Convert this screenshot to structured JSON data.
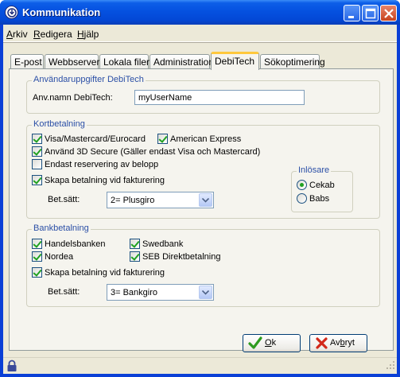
{
  "window": {
    "title": "Kommunikation"
  },
  "menu": {
    "arkiv_first": "A",
    "arkiv_rest": "rkiv",
    "redigera_first": "R",
    "redigera_rest": "edigera",
    "hjalp_first": "H",
    "hjalp_rest": "jälp"
  },
  "tabs": [
    {
      "label": "E-post"
    },
    {
      "label": "Webbserver"
    },
    {
      "label": "Lokala filer"
    },
    {
      "label": "Administration"
    },
    {
      "label": "DebiTech"
    },
    {
      "label": "Sökoptimering"
    }
  ],
  "active_tab": "DebiTech",
  "user_group": {
    "title": "Användaruppgifter DebiTech",
    "username_label": "Anv.namn DebiTech:",
    "username_value": "myUserName"
  },
  "card_group": {
    "title": "Kortbetalning",
    "visa": {
      "label": "Visa/Mastercard/Eurocard",
      "checked": true
    },
    "amex": {
      "label": "American Express",
      "checked": true
    },
    "secure3d": {
      "label": "Använd 3D Secure (Gäller endast Visa och Mastercard)",
      "checked": true
    },
    "reserve": {
      "label": "Endast reservering av belopp",
      "checked": false
    },
    "create_payment": {
      "label": "Skapa betalning vid fakturering",
      "checked": true
    },
    "method_label": "Bet.sätt:",
    "method_value": "2= Plusgiro",
    "acquirer": {
      "title": "Inlösare",
      "cekab": {
        "label": "Cekab",
        "checked": true
      },
      "babs": {
        "label": "Babs",
        "checked": false
      }
    }
  },
  "bank_group": {
    "title": "Bankbetalning",
    "handelsbanken": {
      "label": "Handelsbanken",
      "checked": true
    },
    "swedbank": {
      "label": "Swedbank",
      "checked": true
    },
    "nordea": {
      "label": "Nordea",
      "checked": true
    },
    "seb": {
      "label": "SEB Direktbetalning",
      "checked": true
    },
    "create_payment": {
      "label": "Skapa betalning vid fakturering",
      "checked": true
    },
    "method_label": "Bet.sätt:",
    "method_value": "3= Bankgiro"
  },
  "buttons": {
    "ok_first": "O",
    "ok_rest": "k",
    "cancel_pre": "Av",
    "cancel_u": "b",
    "cancel_rest": "ryt"
  },
  "colors": {
    "title_blue": "#0551e0",
    "group_title": "#2b4fa6",
    "check_green": "#21a121"
  }
}
